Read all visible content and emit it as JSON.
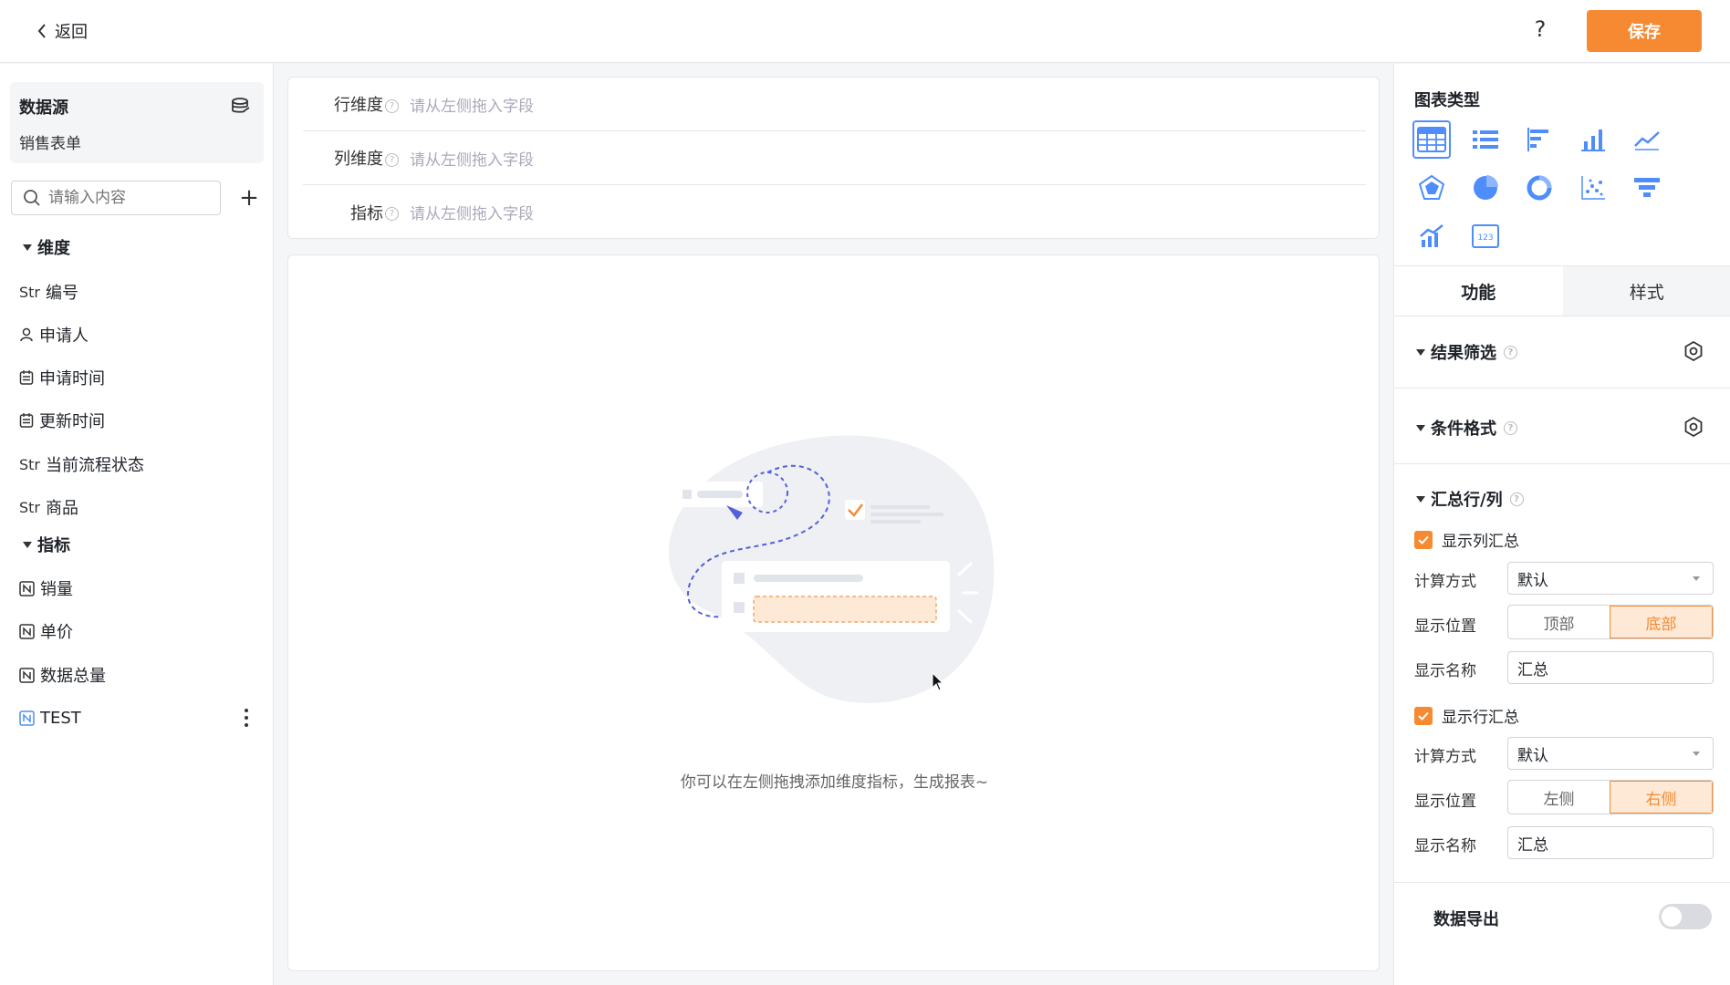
{
  "topbar": {
    "back_label": "返回",
    "help_label": "?",
    "save_label": "保存"
  },
  "left": {
    "datasource_title": "数据源",
    "datasource_name": "销售表单",
    "search_placeholder": "请输入内容",
    "add_label": "+",
    "dimension_title": "维度",
    "dimensions": [
      {
        "type": "Str",
        "label": "编号"
      },
      {
        "type": "person-icon",
        "label": "申请人"
      },
      {
        "type": "calendar-icon",
        "label": "申请时间"
      },
      {
        "type": "calendar-icon",
        "label": "更新时间"
      },
      {
        "type": "Str",
        "label": "当前流程状态"
      },
      {
        "type": "Str",
        "label": "商品"
      }
    ],
    "metric_title": "指标",
    "metrics": [
      {
        "type": "number-icon",
        "label": "销量"
      },
      {
        "type": "number-icon",
        "label": "单价"
      },
      {
        "type": "number-icon",
        "label": "数据总量"
      },
      {
        "type": "number-icon",
        "label": "TEST"
      }
    ]
  },
  "center": {
    "rows": [
      {
        "label": "行维度",
        "placeholder": "请从左侧拖入字段"
      },
      {
        "label": "列维度",
        "placeholder": "请从左侧拖入字段"
      },
      {
        "label": "指标",
        "placeholder": "请从左侧拖入字段"
      }
    ],
    "empty_text": "你可以在左侧拖拽添加维度指标，生成报表~"
  },
  "right": {
    "chart_type_title": "图表类型",
    "chart_types": [
      "table",
      "list",
      "bar-horizontal",
      "bar-vertical",
      "line",
      "radar",
      "pie",
      "donut",
      "scatter",
      "funnel",
      "combo",
      "number-card"
    ],
    "active_chart": "table",
    "tabs": [
      "功能",
      "样式"
    ],
    "active_tab": "功能",
    "result_filter": "结果筛选",
    "conditional_format": "条件格式",
    "summary_title": "汇总行/列",
    "col_summary": {
      "checkbox_label": "显示列汇总",
      "calc_label": "计算方式",
      "calc_value": "默认",
      "pos_label": "显示位置",
      "pos_options": [
        "顶部",
        "底部"
      ],
      "pos_selected": "底部",
      "name_label": "显示名称",
      "name_value": "汇总"
    },
    "row_summary": {
      "checkbox_label": "显示行汇总",
      "calc_label": "计算方式",
      "calc_value": "默认",
      "pos_label": "显示位置",
      "pos_options": [
        "左侧",
        "右侧"
      ],
      "pos_selected": "右侧",
      "name_label": "显示名称",
      "name_value": "汇总"
    },
    "export_label": "数据导出",
    "export_enabled": false
  },
  "colors": {
    "accent": "#f58a33",
    "chart_icon": "#4f8dfb",
    "border": "#e5e6eb"
  }
}
